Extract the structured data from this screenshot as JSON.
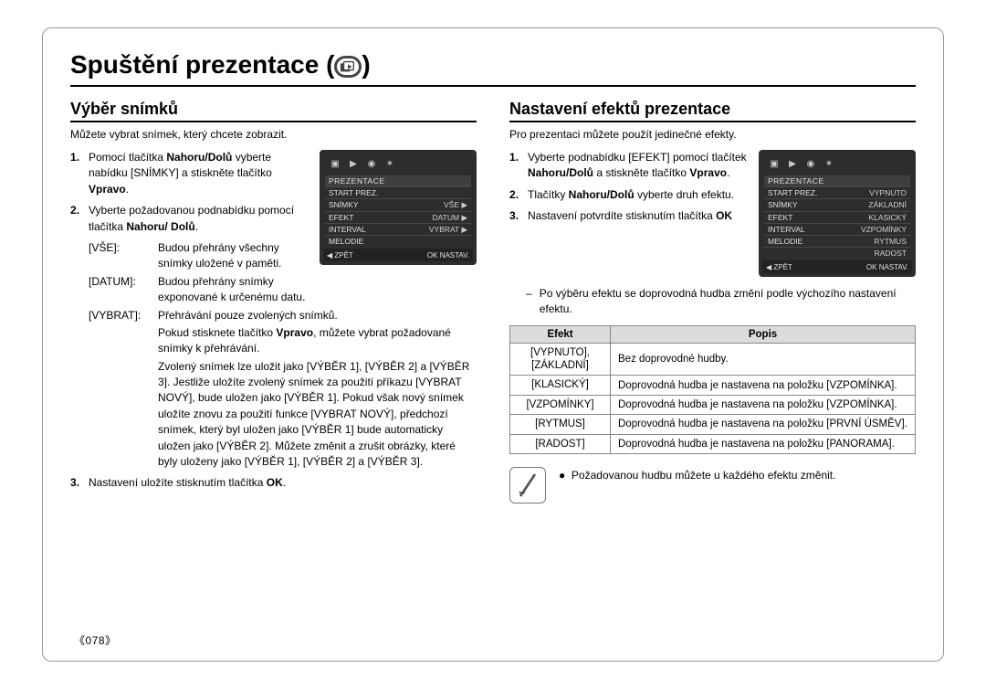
{
  "page": {
    "title": "Spuštění prezentace (",
    "title_close": ")",
    "page_num": "078"
  },
  "left": {
    "heading": "Výběr snímků",
    "intro": "Můžete vybrat snímek, který chcete zobrazit.",
    "step1_a": "Pomocí tlačítka ",
    "step1_b": "Nahoru/Dolů",
    "step1_c": " vyberte nabídku [SNÍMKY] a stiskněte tlačítko ",
    "step1_d": "Vpravo",
    "step1_e": ".",
    "step2_a": "Vyberte požadovanou podnabídku pomocí tlačítka ",
    "step2_b": "Nahoru/ Dolů",
    "step2_c": ".",
    "defs": [
      {
        "term": "[VŠE]:",
        "desc": "Budou přehrány všechny snímky uložené v paměti."
      },
      {
        "term": "[DATUM]:",
        "desc": "Budou přehrány snímky exponované k určenému datu."
      },
      {
        "term": "[VYBRAT]:",
        "desc": "Přehrávání pouze zvolených snímků."
      }
    ],
    "extra1": "Pokud stisknete tlačítko ",
    "extra1b": "Vpravo",
    "extra1c": ", můžete vybrat požadované snímky k přehrávání.",
    "extra2": "Zvolený snímek lze uložit jako [VÝBĚR 1], [VÝBĚR 2] a [VÝBĚR 3]. Jestliže uložíte zvolený snímek za použití příkazu [VYBRAT NOVÝ], bude uložen jako [VÝBĚR 1]. Pokud však nový snímek uložíte znovu za použití funkce [VYBRAT NOVÝ], předchozí snímek, který byl uložen jako [VÝBĚR 1] bude automaticky uložen jako [VÝBĚR 2]. Můžete změnit a zrušit obrázky, které byly uloženy jako [VÝBĚR 1], [VÝBĚR 2] a [VÝBĚR 3].",
    "step3_a": "Nastavení uložíte stisknutím tlačítka ",
    "step3_b": "OK",
    "step3_c": ".",
    "ss": {
      "section": "PREZENTACE",
      "rows": [
        {
          "l": "START PREZ.",
          "r": ""
        },
        {
          "l": "SNÍMKY",
          "r": "VŠE ▶"
        },
        {
          "l": "EFEKT",
          "r": "DATUM ▶"
        },
        {
          "l": "INTERVAL",
          "r": "VYBRAT ▶"
        },
        {
          "l": "MELODIE",
          "r": ""
        }
      ],
      "foot_l": "◀ ZPĚT",
      "foot_r": "OK  NASTAV."
    }
  },
  "right": {
    "heading": "Nastavení efektů prezentace",
    "intro": "Pro prezentaci můžete použít jedinečné efekty.",
    "step1_a": "Vyberte podnabídku [EFEKT] pomocí tlačítek ",
    "step1_b": "Nahoru/Dolů",
    "step1_c": " a stiskněte tlačítko ",
    "step1_d": "Vpravo",
    "step1_e": ".",
    "step2_a": "Tlačítky ",
    "step2_b": "Nahoru/Dolů",
    "step2_c": " vyberte druh efektu.",
    "step3_a": "Nastavení potvrdíte stisknutím tlačítka ",
    "step3_b": "OK",
    "dash_note": "Po výběru efektu se doprovodná hudba změní podle výchozího nastavení efektu.",
    "table": {
      "h_efekt": "Efekt",
      "h_popis": "Popis",
      "rows": [
        {
          "efekt": "[VYPNUTO],\n[ZÁKLADNÍ]",
          "popis": "Bez doprovodné hudby."
        },
        {
          "efekt": "[KLASICKÝ]",
          "popis": "Doprovodná hudba je nastavena na položku [VZPOMÍNKA]."
        },
        {
          "efekt": "[VZPOMÍNKY]",
          "popis": "Doprovodná hudba je nastavena na položku [VZPOMÍNKA]."
        },
        {
          "efekt": "[RYTMUS]",
          "popis": "Doprovodná hudba je nastavena na položku [PRVNÍ ÚSMĚV]."
        },
        {
          "efekt": "[RADOST]",
          "popis": "Doprovodná hudba je nastavena na položku [PANORAMA]."
        }
      ]
    },
    "icon_note": "Požadovanou hudbu můžete u každého efektu změnit.",
    "ss": {
      "section": "PREZENTACE",
      "rows": [
        {
          "l": "START PREZ.",
          "r": "VYPNUTO"
        },
        {
          "l": "SNÍMKY",
          "r": "ZÁKLADNÍ"
        },
        {
          "l": "EFEKT",
          "r": "KLASICKÝ"
        },
        {
          "l": "INTERVAL",
          "r": "VZPOMÍNKY"
        },
        {
          "l": "MELODIE",
          "r": "RYTMUS"
        },
        {
          "l": "",
          "r": "RADOST"
        }
      ],
      "foot_l": "◀ ZPĚT",
      "foot_r": "OK  NASTAV."
    }
  }
}
